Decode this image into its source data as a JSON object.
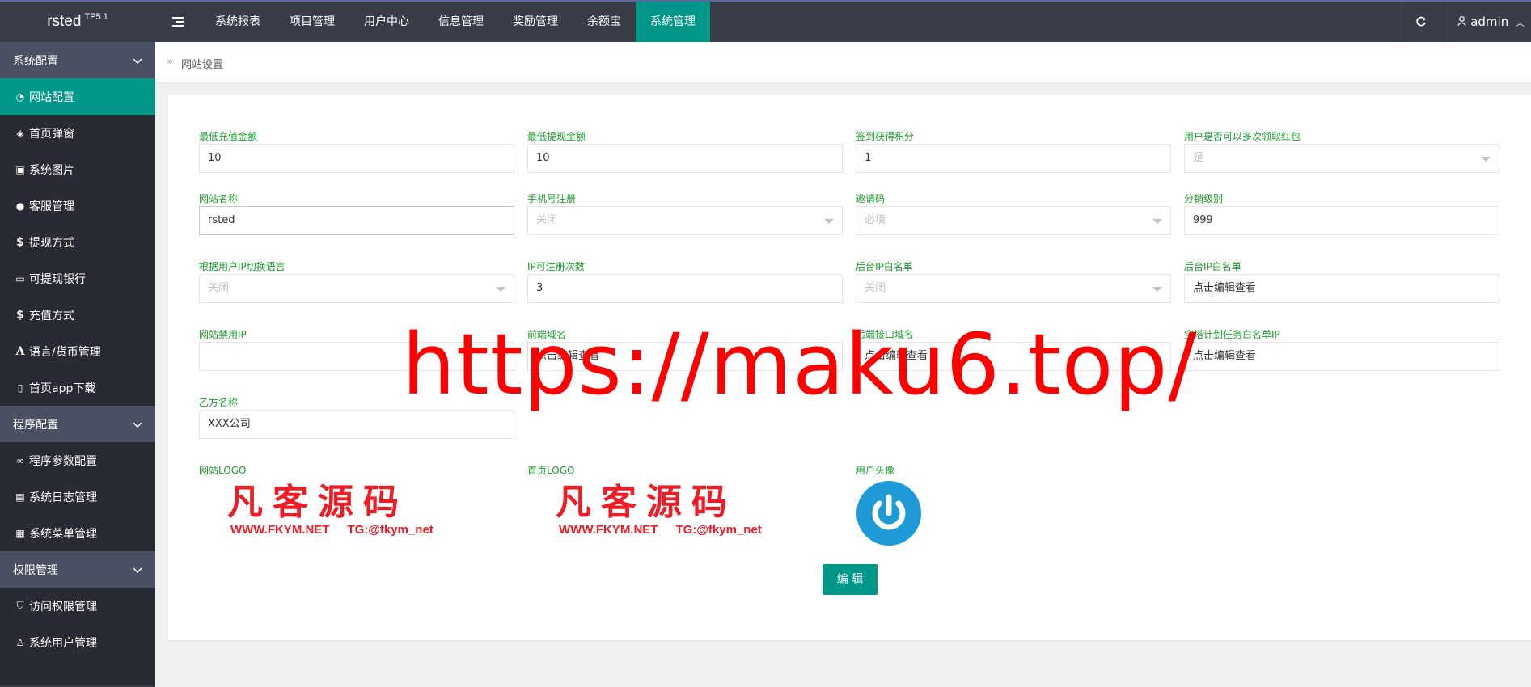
{
  "header": {
    "logo": "rsted",
    "logo_sup": "TP5.1",
    "nav": [
      "系统报表",
      "项目管理",
      "用户中心",
      "信息管理",
      "奖励管理",
      "余额宝",
      "系统管理"
    ],
    "active_nav": "系统管理",
    "user": "admin"
  },
  "sidebar": {
    "groups": [
      {
        "label": "系统配置",
        "items": [
          "网站配置",
          "首页弹窗",
          "系统图片",
          "客服管理",
          "提现方式",
          "可提现银行",
          "充值方式",
          "语言/货币管理",
          "首页app下载"
        ]
      },
      {
        "label": "程序配置",
        "items": [
          "程序参数配置",
          "系统日志管理",
          "系统菜单管理"
        ]
      },
      {
        "label": "权限管理",
        "items": [
          "访问权限管理",
          "系统用户管理"
        ]
      }
    ],
    "active_item": "网站配置"
  },
  "breadcrumb": "网站设置",
  "form": {
    "fields": [
      {
        "label": "最低充值金额",
        "value": "10",
        "type": "text"
      },
      {
        "label": "最低提现金额",
        "value": "10",
        "type": "text"
      },
      {
        "label": "签到获得积分",
        "value": "1",
        "type": "text"
      },
      {
        "label": "用户是否可以多次领取红包",
        "value": "是",
        "type": "select"
      },
      {
        "label": "网站名称",
        "value": "rsted",
        "type": "text"
      },
      {
        "label": "手机号注册",
        "value": "关闭",
        "type": "select"
      },
      {
        "label": "邀请码",
        "value": "必填",
        "type": "select"
      },
      {
        "label": "分销级别",
        "value": "999",
        "type": "text"
      },
      {
        "label": "根据用户IP切换语言",
        "value": "关闭",
        "type": "select"
      },
      {
        "label": "IP可注册次数",
        "value": "3",
        "type": "text"
      },
      {
        "label": "后台IP白名单",
        "value": "关闭",
        "type": "select"
      },
      {
        "label": "后台IP白名单",
        "value": "点击编辑查看",
        "type": "text"
      },
      {
        "label": "网站禁用IP",
        "value": "",
        "type": "text"
      },
      {
        "label": "前端域名",
        "value": "点击编辑查看",
        "type": "text"
      },
      {
        "label": "后端接口域名",
        "value": "点击编辑查看",
        "type": "text"
      },
      {
        "label": "宝塔计划任务白名单IP",
        "value": "点击编辑查看",
        "type": "text"
      },
      {
        "label": "乙方名称",
        "value": "XXX公司",
        "type": "text"
      }
    ],
    "site_logo_label": "网站LOGO",
    "home_logo_label": "首页LOGO",
    "avatar_label": "用户头像",
    "logo_cn": "凡客源码",
    "logo_site": "WWW.FKYM.NET",
    "logo_tg": "TG:@fkym_net",
    "edit_button": "编 辑"
  },
  "watermark": "https://maku6.top/",
  "colors": {
    "accent": "#009688",
    "sidebar": "#393d49",
    "label_green": "#1a9c2c",
    "watermark": "#ff0000"
  }
}
